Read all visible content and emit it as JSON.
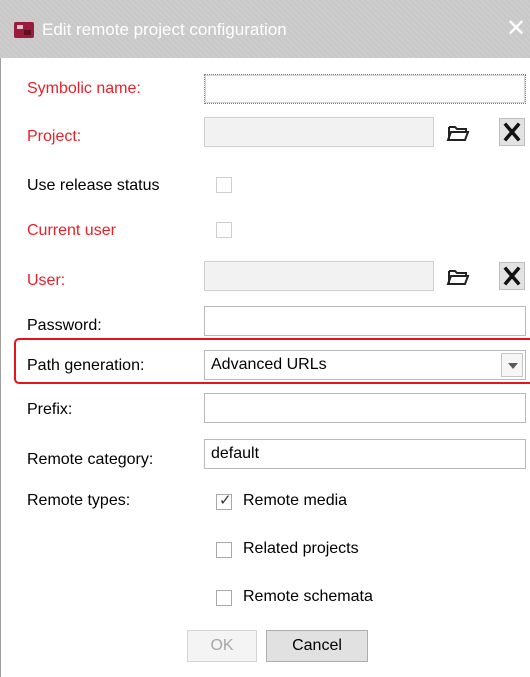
{
  "window": {
    "title": "Edit remote project configuration",
    "close_glyph": "✕"
  },
  "form": {
    "symbolic_name": {
      "label": "Symbolic name:",
      "value": ""
    },
    "project": {
      "label": "Project:",
      "value": ""
    },
    "use_release_status": {
      "label": "Use release status",
      "checked": false
    },
    "current_user": {
      "label": "Current user",
      "checked": false
    },
    "user": {
      "label": "User:",
      "value": ""
    },
    "password": {
      "label": "Password:",
      "value": ""
    },
    "path_generation": {
      "label": "Path generation:",
      "selected": "Advanced URLs"
    },
    "prefix": {
      "label": "Prefix:",
      "value": ""
    },
    "remote_category": {
      "label": "Remote category:",
      "value": "default"
    },
    "remote_types": {
      "label": "Remote types:",
      "options": [
        {
          "label": "Remote media",
          "checked": true
        },
        {
          "label": "Related projects",
          "checked": false
        },
        {
          "label": "Remote schemata",
          "checked": false
        }
      ]
    }
  },
  "buttons": {
    "ok": "OK",
    "cancel": "Cancel"
  },
  "colors": {
    "required_label": "#e8202a",
    "highlight": "#e3151a",
    "titlebar": "#c8c8c8"
  },
  "icons": {
    "browse": "folder-open-icon",
    "clear": "close-icon",
    "app": "app-logo-icon"
  }
}
